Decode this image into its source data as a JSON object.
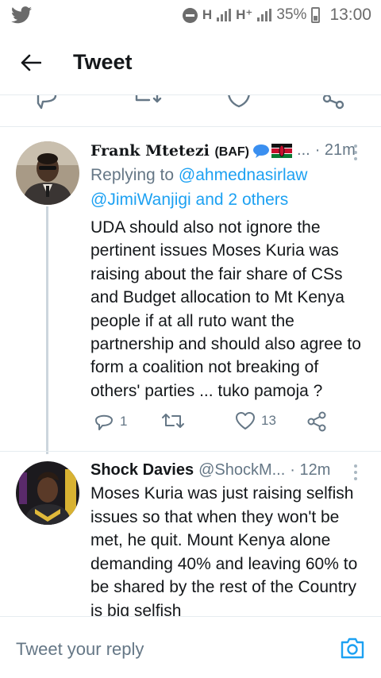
{
  "status_bar": {
    "network_1": "H",
    "network_2": "H⁺",
    "battery": "35%",
    "time": "13:00"
  },
  "header": {
    "title": "Tweet"
  },
  "tweets": [
    {
      "name": "Frank Mtetezi",
      "name_tag": "(BAF)",
      "handle": "...",
      "time": "21m",
      "replying_prefix": "Replying to ",
      "mention_1": "@ahmednasirlaw",
      "mention_2": "@JimiWanjigi",
      "replying_suffix": " and 2 others",
      "text": "UDA should also not ignore the pertinent issues Moses Kuria was raising about the fair share of CSs and Budget allocation to Mt Kenya people if at all ruto want the partnership and should also agree to form a coalition not breaking of others' parties ... tuko pamoja ?",
      "reply_count": "1",
      "retweet_count": "",
      "like_count": "13"
    },
    {
      "name": "Shock Davies",
      "handle": "@ShockM...",
      "time": "· 12m",
      "text": "Moses Kuria was just raising selfish issues so that when they won't be met, he quit. Mount Kenya alone demanding 40% and leaving 60% to be shared by the rest of the Country is big selfish"
    }
  ],
  "reply_bar": {
    "placeholder": "Tweet your reply"
  },
  "icons": {
    "app": "twitter-bird-icon",
    "back": "back-arrow-icon",
    "reply": "reply-icon",
    "retweet": "retweet-icon",
    "like": "heart-icon",
    "share": "share-icon",
    "more": "more-vertical-icon",
    "camera": "camera-icon"
  },
  "colors": {
    "accent": "#1da1f2",
    "text": "#14171a",
    "secondary": "#657786",
    "divider": "#e6ecf0"
  }
}
